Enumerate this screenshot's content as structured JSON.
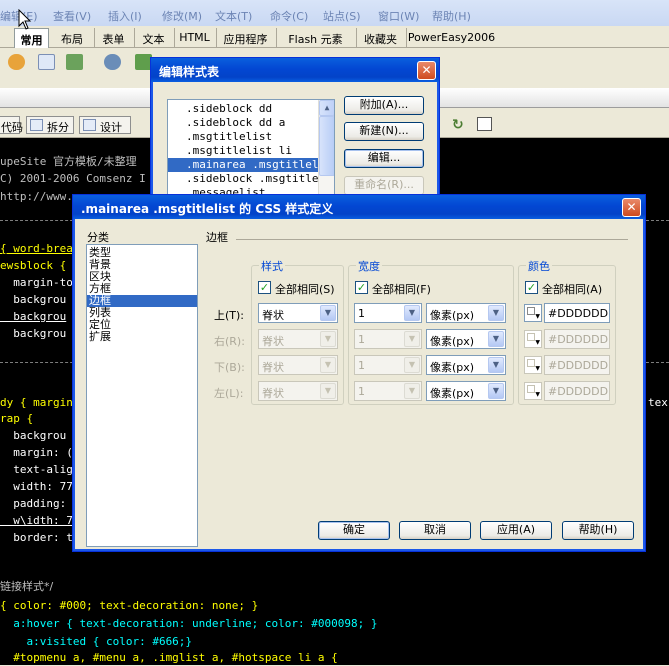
{
  "menubar": [
    "编辑(E)",
    "查看(V)",
    "插入(I)",
    "修改(M)",
    "文本(T)",
    "命令(C)",
    "站点(S)",
    "窗口(W)",
    "帮助(H)"
  ],
  "insert_tabs": [
    "常用",
    "布局",
    "表单",
    "文本",
    "HTML",
    "应用程序",
    "Flash 元素",
    "收藏夹",
    "PowerEasy2006"
  ],
  "view_buttons": [
    "代码",
    "拆分",
    "设计"
  ],
  "code": {
    "header_line_1": "upeSite 官方模板/未整理",
    "header_line_2": "C) 2001-2006 Comsenz I",
    "header_line_3": "http://www.",
    "l1": "{ word-brea",
    "l2": "ewsblock {",
    "l3": "  margin-to",
    "l4": "  backgrou",
    "l5": "  backgrou",
    "l6": "  backgrou",
    "l7": "dy { margin",
    "l7_right": "tex",
    "l8": "rap {",
    "l9": "  backgrou",
    "l10": "  margin: (",
    "l11": "  text-alig",
    "l12": "  width: 77",
    "l13": "  padding:",
    "l14": "  w\\idth: 7",
    "l15": "  border: t",
    "l16": "链接样式*/",
    "l17": "{ color: #000; text-decoration: none; }",
    "l18": "  a:hover { text-decoration: underline; color: #000098; }",
    "l19": "    a:visited { color: #666;}",
    "l20": "  #topmenu a, #menu a, .imglist a, #hotspace li a {"
  },
  "stylesheet_dialog": {
    "title": "编辑样式表",
    "items": [
      ".sideblock dd",
      ".sideblock dd a",
      ".msgtitlelist",
      ".msgtitlelist li",
      ".mainarea .msgtitlelist",
      ".sideblock .msgtitlel",
      ".messagelist"
    ],
    "selected_index": 4,
    "buttons": [
      "附加(A)...",
      "新建(N)...",
      "编辑...",
      "重命名(R)..."
    ]
  },
  "css_dialog": {
    "title": ".mainarea .msgtitlelist 的 CSS 样式定义",
    "category_label": "分类",
    "categories": [
      "类型",
      "背景",
      "区块",
      "方框",
      "边框",
      "列表",
      "定位",
      "扩展"
    ],
    "selected_category": 4,
    "section_title": "边框",
    "groups": {
      "style": "样式",
      "width": "宽度",
      "color": "颜色"
    },
    "same_for_all": "全部相同",
    "same_style_key": "(S)",
    "same_width_key": "(F)",
    "same_color_key": "(A)",
    "rows": [
      {
        "label": "上(T):",
        "style": "脊状",
        "width": "1",
        "unit": "像素(px)",
        "color": "#DDDDDD",
        "enabled": true
      },
      {
        "label": "右(R):",
        "style": "脊状",
        "width": "1",
        "unit": "像素(px)",
        "color": "#DDDDDD",
        "enabled": false
      },
      {
        "label": "下(B):",
        "style": "脊状",
        "width": "1",
        "unit": "像素(px)",
        "color": "#DDDDDD",
        "enabled": false
      },
      {
        "label": "左(L):",
        "style": "脊状",
        "width": "1",
        "unit": "像素(px)",
        "color": "#DDDDDD",
        "enabled": false
      }
    ],
    "buttons": {
      "ok": "确定",
      "cancel": "取消",
      "apply": "应用(A)",
      "help": "帮助(H)"
    }
  },
  "colors": {
    "code_white": "#ffffff",
    "code_yellow": "#ffff00",
    "code_green": "#00ff00",
    "code_cyan": "#00ffff",
    "code_comment": "#bfbfbf",
    "selection": "#316ac5",
    "xp_title": "#0347d3"
  }
}
